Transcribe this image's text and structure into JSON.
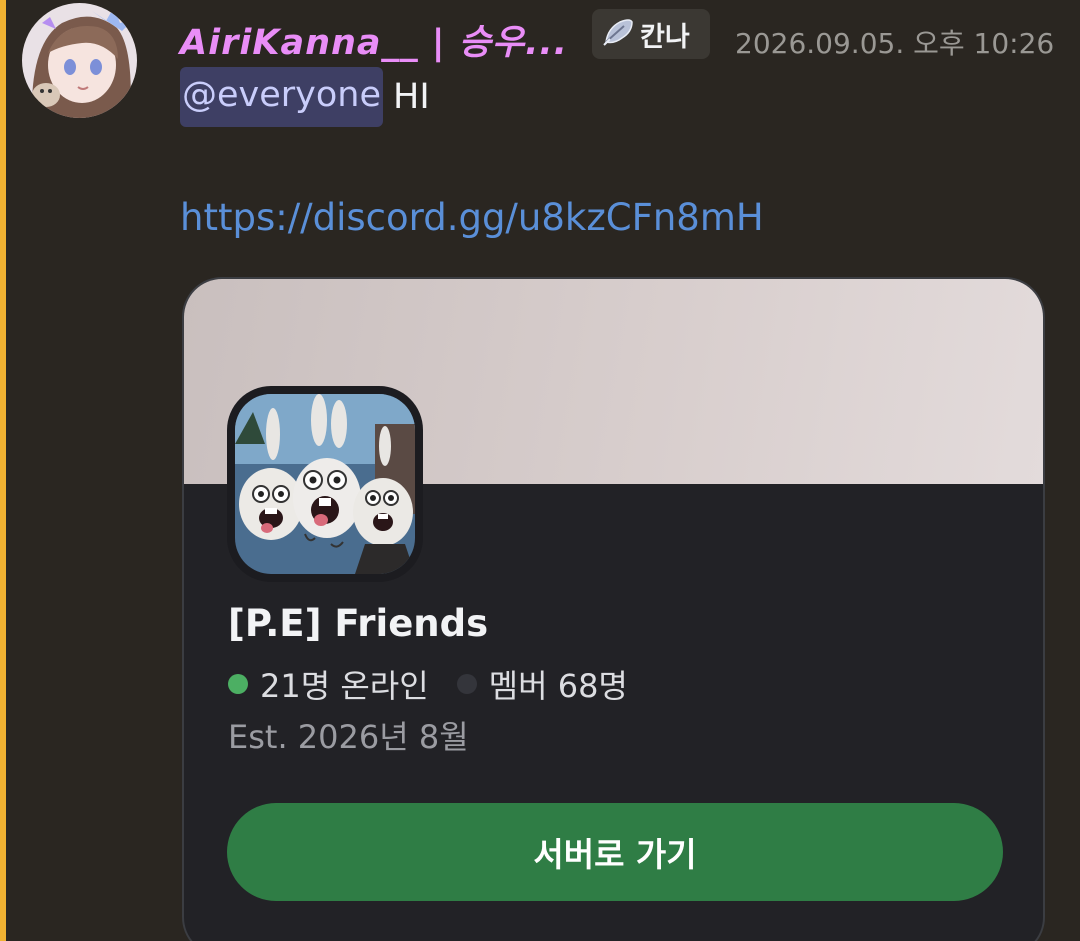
{
  "message": {
    "username": "AiriKanna__ | 승우...",
    "server_tag": {
      "icon": "feather-icon",
      "label": "칸나"
    },
    "timestamp": "2026.09.05. 오후 10:26",
    "mention": "@everyone",
    "text": "HI",
    "link": "https://discord.gg/u8kzCFn8mH",
    "colors": {
      "username": "#e98df7",
      "mention_bg": "#3e3f64",
      "link": "#5a8fd8",
      "highlight_bar": "#f0b232"
    }
  },
  "invite": {
    "server_name": "[P.E] Friends",
    "online": "21명 온라인",
    "members": "멤버 68명",
    "established": "Est. 2026년 8월",
    "join_label": "서버로 가기",
    "colors": {
      "online_dot": "#4caf63",
      "button": "#2f7d45"
    }
  }
}
